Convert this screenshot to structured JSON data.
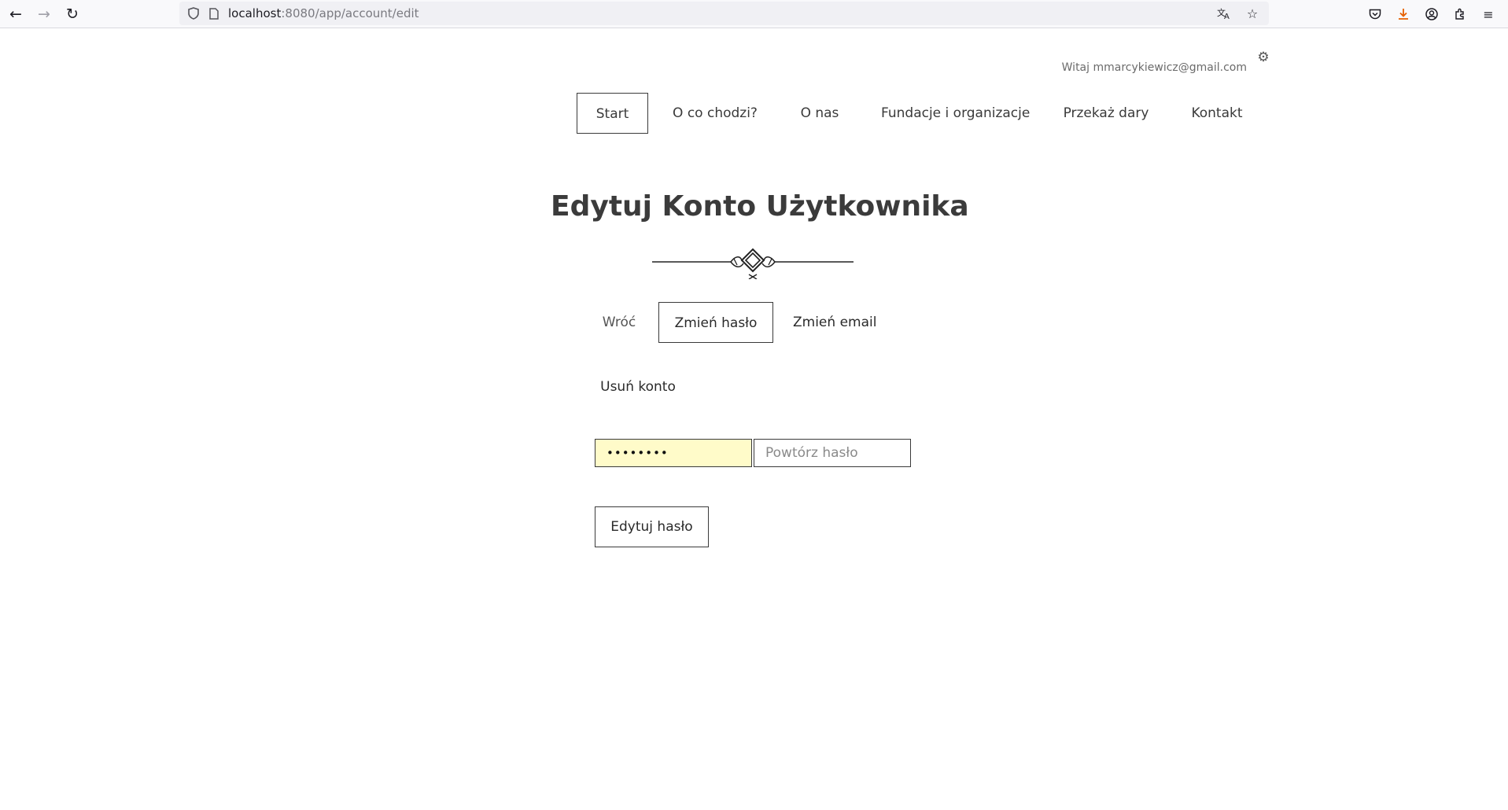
{
  "browser": {
    "url_host": "localhost",
    "url_rest": ":8080/app/account/edit"
  },
  "header": {
    "greeting": "Witaj mmarcykiewicz@gmail.com",
    "nav": {
      "start": "Start",
      "about_what": "O co chodzi?",
      "about_us": "O nas",
      "foundations": "Fundacje i organizacje",
      "donate": "Przekaż dary",
      "contact": "Kontakt"
    }
  },
  "main": {
    "title": "Edytuj Konto Użytkownika",
    "actions": {
      "back": "Wróć",
      "change_password": "Zmień hasło",
      "change_email": "Zmień email",
      "delete_account": "Usuń konto"
    },
    "form": {
      "password_value": "••••••••",
      "repeat_placeholder": "Powtórz hasło",
      "submit": "Edytuj hasło"
    }
  }
}
